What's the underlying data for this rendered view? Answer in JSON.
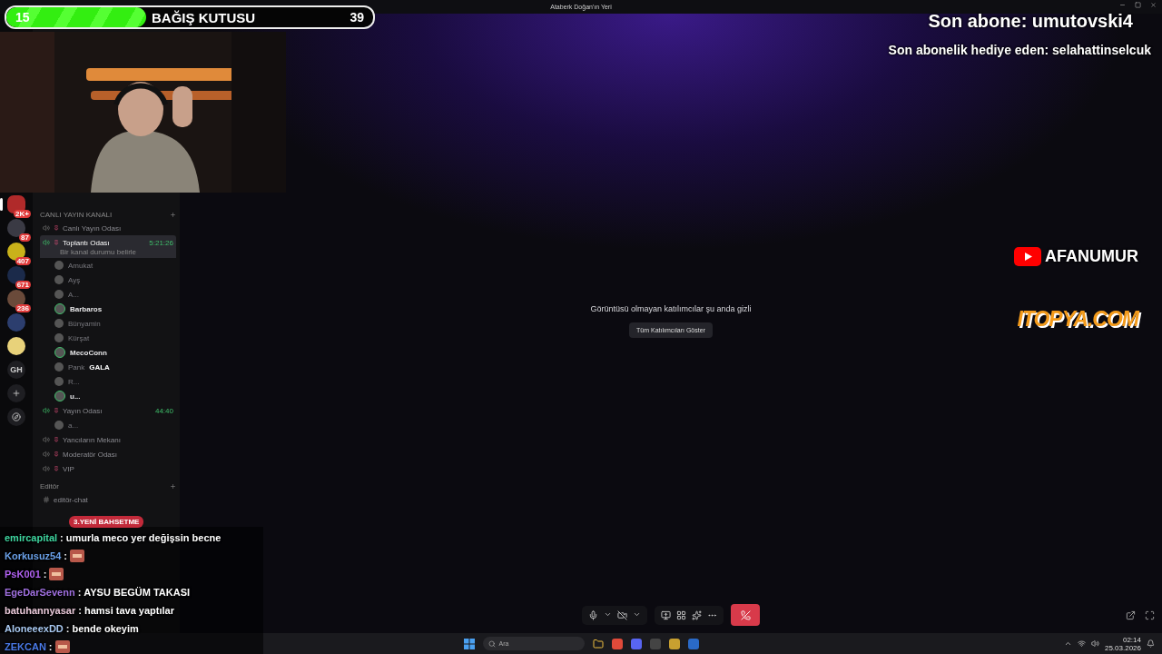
{
  "window": {
    "title": "Ataberk Doğan'ın Yeri"
  },
  "donation_bar": {
    "current": "15",
    "label": "BAĞIŞ KUTUSU",
    "goal": "39",
    "level": 0.38
  },
  "overlays": {
    "last_sub": "Son abone: umutovski4",
    "last_gift": "Son abonelik hediye eden: selahattinselcuk",
    "youtube_channel": "AFANUMUR",
    "sponsor": "ITOPYA.COM"
  },
  "server_rail": [
    {
      "kind": "server",
      "badge": "2K+",
      "selected": true,
      "color": "#b02a2a"
    },
    {
      "kind": "server",
      "badge": "87",
      "selected": false,
      "color": "#3a3a44"
    },
    {
      "kind": "server",
      "badge": "407",
      "selected": false,
      "color": "#c9b21a"
    },
    {
      "kind": "server",
      "badge": "671",
      "selected": false,
      "color": "#1b2a4a"
    },
    {
      "kind": "server",
      "badge": "236",
      "selected": false,
      "color": "#6a4a3a"
    },
    {
      "kind": "server",
      "selected": false,
      "color": "#2c3e6e"
    },
    {
      "kind": "server",
      "selected": false,
      "color": "#e8d27a"
    },
    {
      "kind": "text",
      "label": "GH",
      "selected": false
    },
    {
      "kind": "add",
      "selected": false
    },
    {
      "kind": "explore",
      "selected": false
    }
  ],
  "categories": [
    {
      "name": "CANLI YAYIN KANALI",
      "channels": [
        {
          "kind": "voice",
          "name": "Canlı Yayın Odası",
          "selected": false,
          "live": false
        },
        {
          "kind": "voice",
          "name": "Toplantı Odası",
          "selected": true,
          "live": true,
          "timer": "5:21:26",
          "status": "Bir kanal durumu belirle",
          "users": [
            {
              "name": "Amukat",
              "active": false
            },
            {
              "name": "Ayş",
              "active": false
            },
            {
              "name": "A...",
              "active": false
            },
            {
              "name": "Barbaros",
              "active": true
            },
            {
              "name": "Bünyamin",
              "active": false
            },
            {
              "name": "Kürşat",
              "active": false
            },
            {
              "name": "MecoConn",
              "active": true
            },
            {
              "name": "Pank",
              "active": false,
              "tag": "GALA"
            },
            {
              "name": "R...",
              "active": false
            },
            {
              "name": "u...",
              "active": true
            }
          ]
        },
        {
          "kind": "voice",
          "name": "Yayın Odası",
          "selected": false,
          "live": true,
          "timer": "44:40",
          "users": [
            {
              "name": "a...",
              "active": false
            }
          ]
        },
        {
          "kind": "voice",
          "name": "Yancıların Mekanı",
          "selected": false,
          "live": false
        },
        {
          "kind": "voice",
          "name": "Moderatör Odası",
          "selected": false,
          "live": false
        },
        {
          "kind": "voice",
          "name": "VIP",
          "selected": false,
          "live": false
        }
      ]
    },
    {
      "name": "Editör",
      "channels": [
        {
          "kind": "text",
          "name": "editör-chat",
          "selected": false,
          "live": false
        }
      ]
    }
  ],
  "center": {
    "message": "Görüntüsü olmayan katılımcılar şu anda gizli",
    "button": "Tüm Katılımcıları Göster"
  },
  "chat_tag": "3.YENİ BAHSETME",
  "chat": [
    {
      "user": "emircapital",
      "color": "#3fd6a0",
      "separator": ":",
      "text": "umurla meco yer değişsin becne",
      "emote": false
    },
    {
      "user": "Korkusuz54",
      "color": "#6aa0e8",
      "separator": ":",
      "emote": true
    },
    {
      "user": "PsK001",
      "color": "#b060f0",
      "separator": ":",
      "emote": true
    },
    {
      "user": "EgeDarSevenn",
      "color": "#a070e0",
      "separator": ":",
      "text": "AYSU BEGÜM TAKASI",
      "emote": false
    },
    {
      "user": "batuhannyasar",
      "color": "#e8c8d8",
      "separator": ":",
      "text": "hamsi tava yaptılar",
      "emote": false
    },
    {
      "user": "AloneeexDD",
      "color": "#a8c8f0",
      "separator": ":",
      "text": "bende okeyim",
      "emote": false
    },
    {
      "user": "ZEKCAN",
      "color": "#4a7ae8",
      "separator": ":",
      "emote": true
    }
  ],
  "taskbar": {
    "search_placeholder": "Ara",
    "time": "02:14",
    "date": "25.03.2026"
  }
}
